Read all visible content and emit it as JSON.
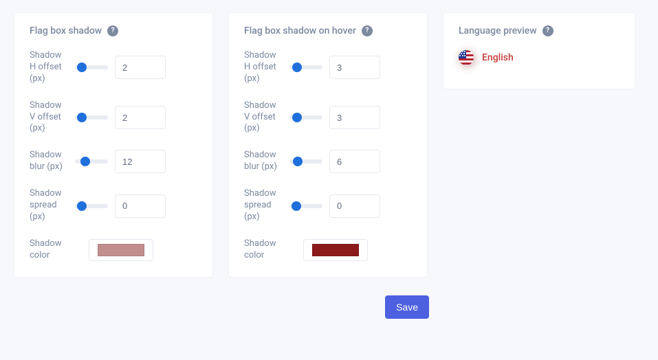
{
  "panel_shadow": {
    "title": "Flag box shadow",
    "fields": {
      "h_offset": {
        "label": "Shadow H offset (px)",
        "value": "2"
      },
      "v_offset": {
        "label": "Shadow V offset (px)",
        "value": "2"
      },
      "blur": {
        "label": "Shadow blur (px)",
        "value": "12"
      },
      "spread": {
        "label": "Shadow spread (px)",
        "value": "0"
      },
      "color": {
        "label": "Shadow color",
        "value": "#C18D8D"
      }
    }
  },
  "panel_hover": {
    "title": "Flag box shadow on hover",
    "fields": {
      "h_offset": {
        "label": "Shadow H offset (px)",
        "value": "3"
      },
      "v_offset": {
        "label": "Shadow V offset (px)",
        "value": "3"
      },
      "blur": {
        "label": "Shadow blur (px)",
        "value": "6"
      },
      "spread": {
        "label": "Shadow spread (px)",
        "value": "0"
      },
      "color": {
        "label": "Shadow color",
        "value": "#8B1A1A"
      }
    }
  },
  "preview": {
    "title": "Language preview",
    "language": "English"
  },
  "actions": {
    "save_label": "Save"
  }
}
